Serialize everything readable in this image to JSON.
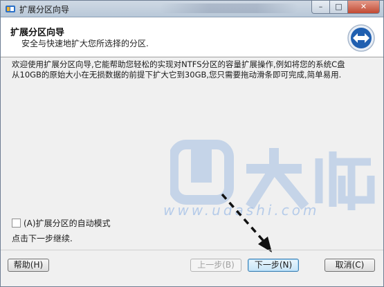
{
  "window": {
    "title": "扩展分区向导",
    "controls": {
      "minimize": "–",
      "maximize": "□",
      "close": "✕"
    }
  },
  "header": {
    "title": "扩展分区向导",
    "subtitle": "安全与快速地扩大您所选择的分区.",
    "icon": "extend-arrows-icon"
  },
  "content": {
    "description": "欢迎使用扩展分区向导,它能帮助您轻松的实现对NTFS分区的容量扩展操作,例如将您的系统C盘从10GB的原始大小在无损数据的前提下扩大它到30GB,您只需要拖动滑条即可完成,简单易用.",
    "watermark_text": "www.udashi.com",
    "checkbox": {
      "label": "(A)扩展分区的自动模式",
      "checked": false
    },
    "hint": "点击下一步继续."
  },
  "buttons": {
    "help": "帮助(H)",
    "prev": "上一步(B)",
    "next": "下一步(N)",
    "cancel": "取消(C)"
  },
  "colors": {
    "accent": "#3c7fb1",
    "icon_blue": "#1f5fb0"
  }
}
